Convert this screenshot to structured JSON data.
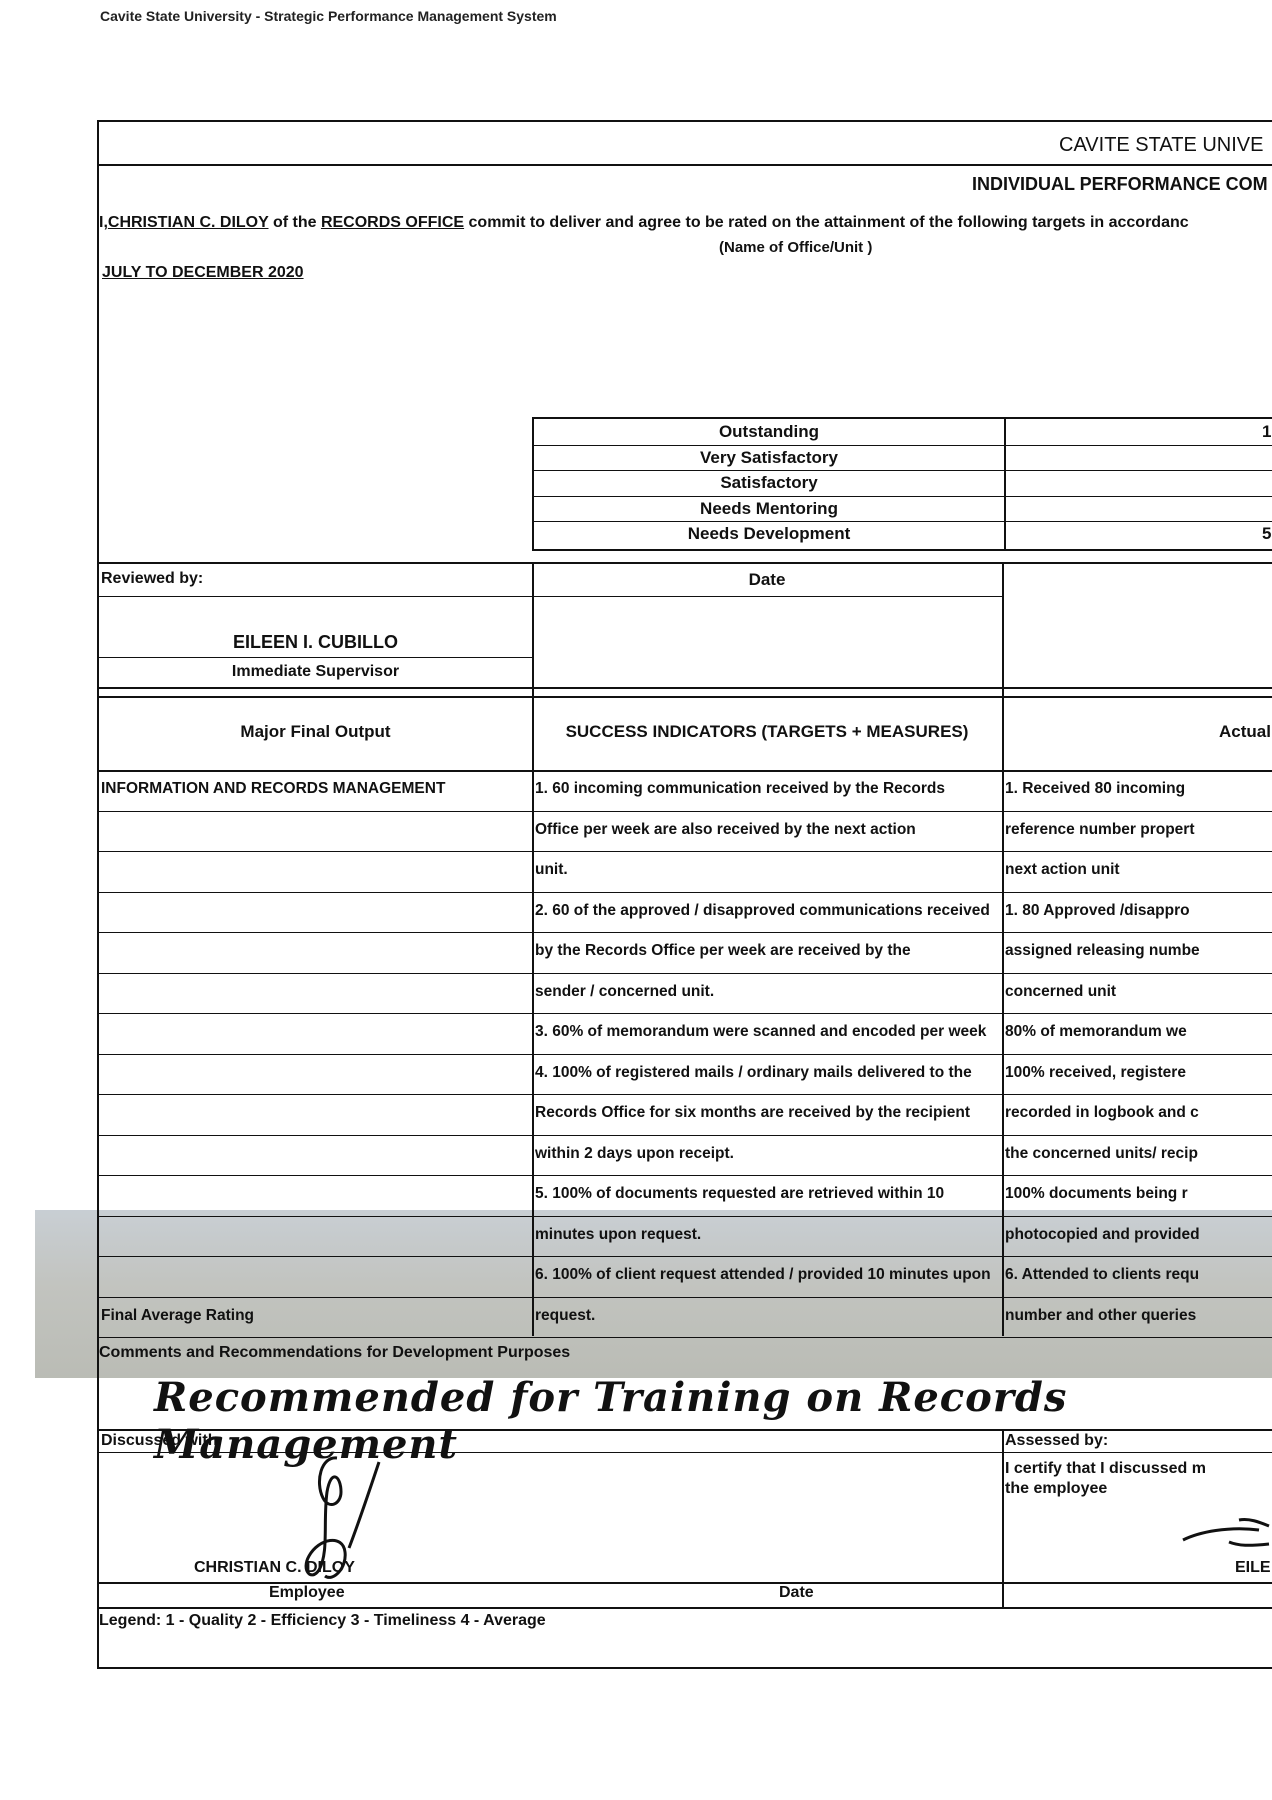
{
  "page_header": "Cavite State University - Strategic Performance Management System",
  "form": {
    "university": "CAVITE STATE UNIVE",
    "form_title": "INDIVIDUAL PERFORMANCE COM",
    "commitment": {
      "prefix": "I,",
      "employee": "CHRISTIAN C. DILOY",
      "of_the": "of the",
      "office": "RECORDS OFFICE",
      "statement": "commit to deliver and agree to be rated on the attainment of the following targets in accordanc",
      "office_caption": "(Name of Office/Unit )"
    },
    "period": "JULY TO DECEMBER 2020",
    "ratings": [
      {
        "label": "Outstanding",
        "value": "1"
      },
      {
        "label": "Very Satisfactory",
        "value": ""
      },
      {
        "label": "Satisfactory",
        "value": ""
      },
      {
        "label": "Needs Mentoring",
        "value": ""
      },
      {
        "label": "Needs Development",
        "value": "5"
      }
    ],
    "reviewed_by_label": "Reviewed by:",
    "date_label": "Date",
    "reviewer_name": "EILEEN I. CUBILLO",
    "reviewer_role": "Immediate Supervisor",
    "columns": {
      "mfo": "Major Final Output",
      "success": "SUCCESS INDICATORS (TARGETS + MEASURES)",
      "actual": "Actual"
    },
    "rows": [
      {
        "mfo": "INFORMATION AND RECORDS MANAGEMENT",
        "success": "1. 60 incoming communication received by the Records",
        "actual": "1. Received 80 incoming"
      },
      {
        "mfo": "",
        "success": "Office per week are also received by the next action",
        "actual": "reference number propert"
      },
      {
        "mfo": "",
        "success": "unit.",
        "actual": "next action unit"
      },
      {
        "mfo": "",
        "success": "2. 60  of the approved / disapproved communications  received",
        "actual": "1. 80 Approved /disappro"
      },
      {
        "mfo": "",
        "success": "by the Records Office per week are received by the",
        "actual": "assigned releasing numbe"
      },
      {
        "mfo": "",
        "success": "sender / concerned unit.",
        "actual": "concerned unit"
      },
      {
        "mfo": "",
        "success": "3. 60% of memorandum were scanned and encoded per week",
        "actual": "80% of memorandum we"
      },
      {
        "mfo": "",
        "success": "4. 100% of registered  mails / ordinary mails delivered to the",
        "actual": "100% received, registere"
      },
      {
        "mfo": "",
        "success": "Records Office for six months are received by the recipient",
        "actual": "recorded in logbook and c"
      },
      {
        "mfo": "",
        "success": "within  2 days upon receipt.",
        "actual": "the concerned units/ recip"
      },
      {
        "mfo": "",
        "success": "5. 100% of documents requested are retrieved within 10",
        "actual": "100% documents being r"
      },
      {
        "mfo": "",
        "success": "minutes upon request.",
        "actual": "photocopied and provided"
      },
      {
        "mfo": "",
        "success": "6. 100% of client request attended / provided  10 minutes upon",
        "actual": "6. Attended to clients requ"
      },
      {
        "mfo": "Final Average Rating",
        "success": "request.",
        "actual": "number and other queries"
      }
    ],
    "comments_label": "Comments and Recommendations for Development Purposes",
    "comments_handwritten": "Recommended for Training on Records Management",
    "discussed_with_label": "Discussed with",
    "employee_name": "CHRISTIAN C. DILOY",
    "employee_role": "Employee",
    "bottom_date_label": "Date",
    "assessed_by_label": "Assessed by:",
    "certify_text_1": "I certify that I discussed m",
    "certify_text_2": "the employee",
    "assessor_name": "EILE",
    "legend": "Legend: 1 - Quality   2 - Efficiency   3 - Timeliness   4 - Average"
  }
}
